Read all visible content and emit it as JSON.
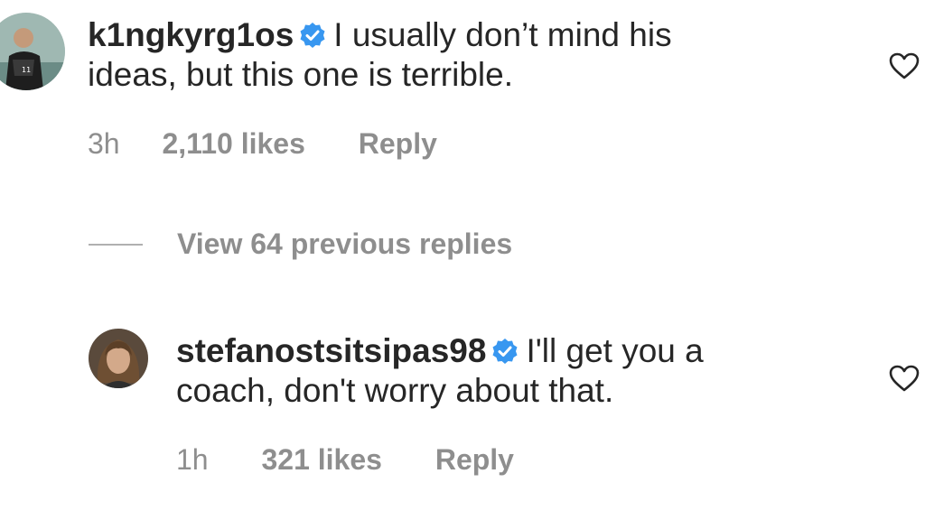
{
  "comments": [
    {
      "username": "k1ngkyrg1os",
      "text_line1": "I usually don’t mind his",
      "text_line2": "ideas, but this one is terrible.",
      "time": "3h",
      "likes": "2,110 likes",
      "reply": "Reply",
      "avatar_icon": "avatar-basketball-player",
      "verified_icon": "verified-badge-icon",
      "like_icon": "heart-icon"
    },
    {
      "username": "stefanostsitsipas98",
      "text_line1": "I'll get you a",
      "text_line2": "coach, don't worry about that.",
      "time": "1h",
      "likes": "321 likes",
      "reply": "Reply",
      "avatar_icon": "avatar-long-hair-person",
      "verified_icon": "verified-badge-icon",
      "like_icon": "heart-icon"
    }
  ],
  "view_replies": "View 64 previous replies",
  "colors": {
    "text": "#262626",
    "muted": "#8e8e8e",
    "verified": "#3897f0"
  }
}
